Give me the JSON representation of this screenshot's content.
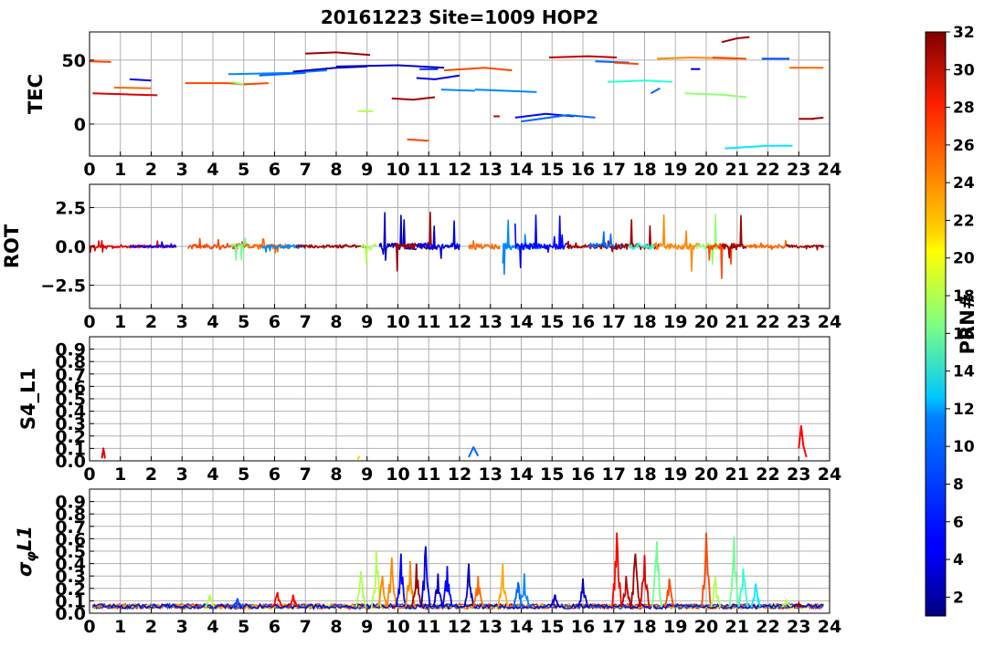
{
  "title": "20161223 Site=1009 HOP2",
  "colorbar": {
    "label": "PRN#",
    "range": [
      1,
      32
    ],
    "ticks": [
      "2",
      "4",
      "6",
      "8",
      "10",
      "12",
      "14",
      "16",
      "18",
      "20",
      "22",
      "24",
      "26",
      "28",
      "30",
      "32"
    ],
    "colormap": "jet"
  },
  "chart_data": [
    {
      "type": "line",
      "panel": "TEC",
      "ylabel": "TEC",
      "xlim": [
        0,
        24
      ],
      "ylim": [
        -25,
        72
      ],
      "x_ticks": [
        "0",
        "1",
        "2",
        "3",
        "4",
        "5",
        "6",
        "7",
        "8",
        "9",
        "10",
        "11",
        "12",
        "13",
        "14",
        "15",
        "16",
        "17",
        "18",
        "19",
        "20",
        "21",
        "22",
        "23",
        "24"
      ],
      "y_ticks": [
        {
          "v": 0,
          "label": "0"
        },
        {
          "v": 50,
          "label": "50"
        }
      ],
      "grid": true,
      "series": [
        {
          "prn": 26,
          "x": [
            0,
            0.7
          ],
          "y": [
            49,
            48.5
          ]
        },
        {
          "prn": 29,
          "x": [
            0.1,
            1.5,
            2.2
          ],
          "y": [
            24,
            23,
            22.5
          ]
        },
        {
          "prn": 25,
          "x": [
            0.8,
            2.0
          ],
          "y": [
            28.5,
            28
          ]
        },
        {
          "prn": 5,
          "x": [
            1.3,
            2.0
          ],
          "y": [
            35,
            34
          ]
        },
        {
          "prn": 26,
          "x": [
            3.1,
            4.5,
            5.1
          ],
          "y": [
            32,
            32,
            31
          ]
        },
        {
          "prn": 26,
          "x": [
            4.9,
            5.8
          ],
          "y": [
            31,
            32
          ]
        },
        {
          "prn": 17,
          "x": [
            4.6,
            5.0
          ],
          "y": [
            33,
            31
          ]
        },
        {
          "prn": 9,
          "x": [
            4.5,
            6.5,
            7.7
          ],
          "y": [
            39,
            40,
            42
          ]
        },
        {
          "prn": 8,
          "x": [
            5.5,
            7.0
          ],
          "y": [
            38,
            40
          ]
        },
        {
          "prn": 3,
          "x": [
            6.6,
            8.0,
            9.0
          ],
          "y": [
            41,
            44,
            45
          ]
        },
        {
          "prn": 31,
          "x": [
            7.0,
            8.0,
            9.1
          ],
          "y": [
            55,
            56,
            54
          ]
        },
        {
          "prn": 3,
          "x": [
            8.0,
            10.0,
            11.5
          ],
          "y": [
            45,
            46,
            44
          ]
        },
        {
          "prn": 18,
          "x": [
            8.7,
            9.2
          ],
          "y": [
            10,
            10
          ]
        },
        {
          "prn": 31,
          "x": [
            9.8,
            10.5,
            11.2
          ],
          "y": [
            20,
            19,
            21
          ]
        },
        {
          "prn": 26,
          "x": [
            10.3,
            11.0
          ],
          "y": [
            -12,
            -13
          ]
        },
        {
          "prn": 4,
          "x": [
            10.6,
            11.2,
            12.0
          ],
          "y": [
            36,
            35,
            38
          ]
        },
        {
          "prn": 6,
          "x": [
            10.7,
            11.3
          ],
          "y": [
            43,
            43
          ]
        },
        {
          "prn": 9,
          "x": [
            11.4,
            12.5
          ],
          "y": [
            27,
            26
          ]
        },
        {
          "prn": 9,
          "x": [
            12.5,
            14.5
          ],
          "y": [
            27,
            25
          ]
        },
        {
          "prn": 26,
          "x": [
            11.5,
            12.8,
            13.7
          ],
          "y": [
            42,
            44,
            42
          ]
        },
        {
          "prn": 30,
          "x": [
            13.1,
            13.3
          ],
          "y": [
            6,
            6
          ]
        },
        {
          "prn": 5,
          "x": [
            13.8,
            14.8,
            15.7
          ],
          "y": [
            5,
            8,
            6
          ]
        },
        {
          "prn": 8,
          "x": [
            14.0,
            15.5,
            16.4
          ],
          "y": [
            2,
            7,
            5
          ]
        },
        {
          "prn": 30,
          "x": [
            14.9,
            16.2,
            17.1
          ],
          "y": [
            52,
            53,
            52
          ]
        },
        {
          "prn": 8,
          "x": [
            16.4,
            17.5
          ],
          "y": [
            49,
            48
          ]
        },
        {
          "prn": 26,
          "x": [
            17.0,
            17.8
          ],
          "y": [
            48,
            47
          ]
        },
        {
          "prn": 14,
          "x": [
            16.8,
            18.0,
            18.9
          ],
          "y": [
            33,
            34,
            33
          ]
        },
        {
          "prn": 8,
          "x": [
            18.2,
            18.5
          ],
          "y": [
            24,
            28
          ]
        },
        {
          "prn": 24,
          "x": [
            18.4,
            19.5,
            21.0
          ],
          "y": [
            51,
            52,
            51
          ]
        },
        {
          "prn": 3,
          "x": [
            19.5,
            19.8
          ],
          "y": [
            43,
            43
          ]
        },
        {
          "prn": 17,
          "x": [
            19.3,
            20.5,
            21.3
          ],
          "y": [
            24,
            23,
            21
          ]
        },
        {
          "prn": 31,
          "x": [
            20.5,
            21.0,
            21.4
          ],
          "y": [
            64,
            67,
            68
          ]
        },
        {
          "prn": 26,
          "x": [
            20.2,
            21.3
          ],
          "y": [
            52,
            51
          ]
        },
        {
          "prn": 7,
          "x": [
            21.8,
            22.7
          ],
          "y": [
            51,
            51
          ]
        },
        {
          "prn": 25,
          "x": [
            22.7,
            23.8
          ],
          "y": [
            44,
            44
          ]
        },
        {
          "prn": 12,
          "x": [
            20.6,
            22.0,
            22.8
          ],
          "y": [
            -19,
            -17,
            -17
          ]
        },
        {
          "prn": 31,
          "x": [
            23.0,
            23.5
          ],
          "y": [
            4,
            4
          ]
        },
        {
          "prn": 31,
          "x": [
            23.4,
            23.8
          ],
          "y": [
            4,
            5
          ]
        }
      ]
    },
    {
      "type": "line",
      "panel": "ROT",
      "ylabel": "ROT",
      "xlim": [
        0,
        24
      ],
      "ylim": [
        -4,
        4
      ],
      "x_ticks": [
        "0",
        "1",
        "2",
        "3",
        "4",
        "5",
        "6",
        "7",
        "8",
        "9",
        "10",
        "11",
        "12",
        "13",
        "14",
        "15",
        "16",
        "17",
        "18",
        "19",
        "20",
        "21",
        "22",
        "23",
        "24"
      ],
      "y_ticks": [
        {
          "v": 2.5,
          "label": "2.5"
        },
        {
          "v": 0,
          "label": "0.0"
        },
        {
          "v": -2.5,
          "label": "−2.5"
        }
      ],
      "grid": true,
      "activity": [
        {
          "x": [
            0,
            2.8
          ],
          "amp": 0.4,
          "prn": 29
        },
        {
          "x": [
            1.3,
            2.8
          ],
          "amp": 0.3,
          "prn": 5
        },
        {
          "x": [
            3.2,
            5.0
          ],
          "amp": 0.7,
          "prn": 26
        },
        {
          "x": [
            4.6,
            5.2
          ],
          "amp": 1.5,
          "prn": 16
        },
        {
          "x": [
            5.0,
            6.5
          ],
          "amp": 0.6,
          "prn": 25
        },
        {
          "x": [
            5.6,
            7.0
          ],
          "amp": 0.5,
          "prn": 9
        },
        {
          "x": [
            6.7,
            9.0
          ],
          "amp": 0.4,
          "prn": 31
        },
        {
          "x": [
            8.8,
            9.3
          ],
          "amp": 1.2,
          "prn": 18
        },
        {
          "x": [
            9.4,
            10.6
          ],
          "amp": 2.2,
          "prn": 3
        },
        {
          "x": [
            9.9,
            11.2
          ],
          "amp": 2.5,
          "prn": 31
        },
        {
          "x": [
            10.6,
            12.0
          ],
          "amp": 2.8,
          "prn": 4
        },
        {
          "x": [
            12.3,
            13.3
          ],
          "amp": 1.8,
          "prn": 25
        },
        {
          "x": [
            13.4,
            14.6
          ],
          "amp": 2.5,
          "prn": 9
        },
        {
          "x": [
            13.8,
            15.5
          ],
          "amp": 2.6,
          "prn": 5
        },
        {
          "x": [
            15.5,
            17.0
          ],
          "amp": 0.6,
          "prn": 31
        },
        {
          "x": [
            16.2,
            17.3
          ],
          "amp": 1.0,
          "prn": 8
        },
        {
          "x": [
            17.0,
            18.5
          ],
          "amp": 1.8,
          "prn": 31
        },
        {
          "x": [
            17.5,
            18.3
          ],
          "amp": 1.6,
          "prn": 14
        },
        {
          "x": [
            18.3,
            19.8
          ],
          "amp": 2.8,
          "prn": 24
        },
        {
          "x": [
            19.7,
            20.6
          ],
          "amp": 3.0,
          "prn": 17
        },
        {
          "x": [
            20.0,
            21.0
          ],
          "amp": 2.5,
          "prn": 26
        },
        {
          "x": [
            20.5,
            21.3
          ],
          "amp": 2.0,
          "prn": 31
        },
        {
          "x": [
            21.3,
            22.6
          ],
          "amp": 0.5,
          "prn": 25
        },
        {
          "x": [
            22.6,
            23.8
          ],
          "amp": 0.4,
          "prn": 31
        }
      ]
    },
    {
      "type": "line",
      "panel": "S4_L1",
      "ylabel": "S4_L1",
      "xlim": [
        0,
        24
      ],
      "ylim": [
        0,
        1
      ],
      "x_ticks": [
        "0",
        "1",
        "2",
        "3",
        "4",
        "5",
        "6",
        "7",
        "8",
        "9",
        "10",
        "11",
        "12",
        "13",
        "14",
        "15",
        "16",
        "17",
        "18",
        "19",
        "20",
        "21",
        "22",
        "23",
        "24"
      ],
      "y_ticks": [
        {
          "v": 0,
          "label": "0.0"
        },
        {
          "v": 0.1,
          "label": "0.1"
        },
        {
          "v": 0.2,
          "label": "0.2"
        },
        {
          "v": 0.3,
          "label": "0.3"
        },
        {
          "v": 0.4,
          "label": "0.4"
        },
        {
          "v": 0.5,
          "label": "0.5"
        },
        {
          "v": 0.6,
          "label": "0.6"
        },
        {
          "v": 0.7,
          "label": "0.7"
        },
        {
          "v": 0.8,
          "label": "0.8"
        },
        {
          "v": 0.9,
          "label": "0.9"
        }
      ],
      "grid": true,
      "series": [
        {
          "prn": 29,
          "x": [
            0.4,
            0.45,
            0.5
          ],
          "y": [
            0.02,
            0.1,
            0.02
          ]
        },
        {
          "prn": 8,
          "x": [
            12.3,
            12.45,
            12.6
          ],
          "y": [
            0.03,
            0.11,
            0.04
          ]
        },
        {
          "prn": 28,
          "x": [
            23.0,
            23.08,
            23.15,
            23.25
          ],
          "y": [
            0.1,
            0.28,
            0.12,
            0.03
          ]
        },
        {
          "prn": 22,
          "x": [
            8.7,
            8.75
          ],
          "y": [
            0.01,
            0.04
          ]
        }
      ]
    },
    {
      "type": "line",
      "panel": "sigma_phi_L1",
      "ylabel": "σφL1",
      "xlim": [
        0,
        24
      ],
      "ylim": [
        0,
        1
      ],
      "x_ticks": [
        "0",
        "1",
        "2",
        "3",
        "4",
        "5",
        "6",
        "7",
        "8",
        "9",
        "10",
        "11",
        "12",
        "13",
        "14",
        "15",
        "16",
        "17",
        "18",
        "19",
        "20",
        "21",
        "22",
        "23",
        "24"
      ],
      "y_ticks": [
        {
          "v": 0,
          "label": "0.0"
        },
        {
          "v": 0.1,
          "label": "0.1"
        },
        {
          "v": 0.2,
          "label": "0.2"
        },
        {
          "v": 0.3,
          "label": "0.3"
        },
        {
          "v": 0.4,
          "label": "0.4"
        },
        {
          "v": 0.5,
          "label": "0.5"
        },
        {
          "v": 0.6,
          "label": "0.6"
        },
        {
          "v": 0.7,
          "label": "0.7"
        },
        {
          "v": 0.8,
          "label": "0.8"
        },
        {
          "v": 0.9,
          "label": "0.9"
        }
      ],
      "grid": true,
      "peaks": [
        {
          "x": 3.9,
          "v": 0.15,
          "prn": 18
        },
        {
          "x": 4.8,
          "v": 0.12,
          "prn": 7
        },
        {
          "x": 6.1,
          "v": 0.17,
          "prn": 28
        },
        {
          "x": 6.6,
          "v": 0.15,
          "prn": 28
        },
        {
          "x": 8.8,
          "v": 0.34,
          "prn": 18
        },
        {
          "x": 9.3,
          "v": 0.5,
          "prn": 18
        },
        {
          "x": 9.5,
          "v": 0.3,
          "prn": 24
        },
        {
          "x": 9.8,
          "v": 0.45,
          "prn": 24
        },
        {
          "x": 10.1,
          "v": 0.48,
          "prn": 5
        },
        {
          "x": 10.4,
          "v": 0.42,
          "prn": 24
        },
        {
          "x": 10.6,
          "v": 0.4,
          "prn": 31
        },
        {
          "x": 10.9,
          "v": 0.54,
          "prn": 4
        },
        {
          "x": 11.3,
          "v": 0.32,
          "prn": 3
        },
        {
          "x": 11.6,
          "v": 0.38,
          "prn": 5
        },
        {
          "x": 12.3,
          "v": 0.4,
          "prn": 3
        },
        {
          "x": 12.6,
          "v": 0.3,
          "prn": 25
        },
        {
          "x": 13.4,
          "v": 0.4,
          "prn": 23
        },
        {
          "x": 13.9,
          "v": 0.25,
          "prn": 8
        },
        {
          "x": 14.1,
          "v": 0.32,
          "prn": 9
        },
        {
          "x": 15.1,
          "v": 0.15,
          "prn": 3
        },
        {
          "x": 16.0,
          "v": 0.28,
          "prn": 3
        },
        {
          "x": 17.1,
          "v": 0.65,
          "prn": 28
        },
        {
          "x": 17.4,
          "v": 0.3,
          "prn": 30
        },
        {
          "x": 17.7,
          "v": 0.48,
          "prn": 31
        },
        {
          "x": 18.0,
          "v": 0.47,
          "prn": 29
        },
        {
          "x": 18.4,
          "v": 0.58,
          "prn": 16
        },
        {
          "x": 18.8,
          "v": 0.28,
          "prn": 26
        },
        {
          "x": 20.0,
          "v": 0.65,
          "prn": 26
        },
        {
          "x": 20.3,
          "v": 0.3,
          "prn": 18
        },
        {
          "x": 20.9,
          "v": 0.62,
          "prn": 16
        },
        {
          "x": 21.2,
          "v": 0.36,
          "prn": 14
        },
        {
          "x": 21.6,
          "v": 0.24,
          "prn": 12
        },
        {
          "x": 22.6,
          "v": 0.1,
          "prn": 18
        },
        {
          "x": 23.0,
          "v": 0.08,
          "prn": 31
        }
      ]
    }
  ]
}
